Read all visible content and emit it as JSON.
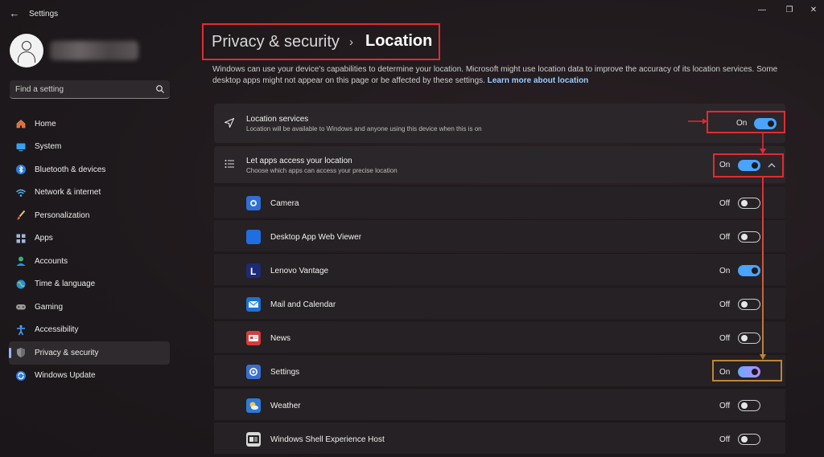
{
  "window": {
    "title": "Settings"
  },
  "profile": {
    "name_blurred": true
  },
  "search": {
    "placeholder": "Find a setting"
  },
  "sidebar": {
    "items": [
      {
        "label": "Home",
        "icon": "home-icon",
        "active": false
      },
      {
        "label": "System",
        "icon": "system-icon",
        "active": false
      },
      {
        "label": "Bluetooth & devices",
        "icon": "bluetooth-icon",
        "active": false
      },
      {
        "label": "Network & internet",
        "icon": "network-icon",
        "active": false
      },
      {
        "label": "Personalization",
        "icon": "brush-icon",
        "active": false
      },
      {
        "label": "Apps",
        "icon": "apps-icon",
        "active": false
      },
      {
        "label": "Accounts",
        "icon": "accounts-icon",
        "active": false
      },
      {
        "label": "Time & language",
        "icon": "globe-icon",
        "active": false
      },
      {
        "label": "Gaming",
        "icon": "gamepad-icon",
        "active": false
      },
      {
        "label": "Accessibility",
        "icon": "accessibility-icon",
        "active": false
      },
      {
        "label": "Privacy & security",
        "icon": "shield-icon",
        "active": true
      },
      {
        "label": "Windows Update",
        "icon": "update-icon",
        "active": false
      }
    ]
  },
  "breadcrumb": {
    "parent": "Privacy & security",
    "separator": "›",
    "current": "Location"
  },
  "description": {
    "text": "Windows can use your device's capabilities to determine your location. Microsoft might use location data to improve the accuracy of its location services. Some desktop apps might not appear on this page or be affected by these settings.",
    "link": "Learn more about location"
  },
  "location_services": {
    "title": "Location services",
    "subtitle": "Location will be available to Windows and anyone using this device when this is on",
    "state": "On"
  },
  "app_access": {
    "title": "Let apps access your location",
    "subtitle": "Choose which apps can access your precise location",
    "state": "On"
  },
  "apps": [
    {
      "name": "Camera",
      "state": "Off",
      "icon": "camera-icon",
      "color": "#2f6fd6"
    },
    {
      "name": "Desktop App Web Viewer",
      "state": "Off",
      "icon": "web-viewer-icon",
      "color": "#1f6fe0"
    },
    {
      "name": "Lenovo Vantage",
      "state": "On",
      "icon": "lenovo-vantage-icon",
      "color": "#1e2a78"
    },
    {
      "name": "Mail and Calendar",
      "state": "Off",
      "icon": "mail-icon",
      "color": "#1a73d6"
    },
    {
      "name": "News",
      "state": "Off",
      "icon": "news-icon",
      "color": "#d83b3b"
    },
    {
      "name": "Settings",
      "state": "On",
      "icon": "settings-gear-icon",
      "color": "#3a6fd0"
    },
    {
      "name": "Weather",
      "state": "Off",
      "icon": "weather-icon",
      "color": "#2f7ad8"
    },
    {
      "name": "Windows Shell Experience Host",
      "state": "Off",
      "icon": "shell-host-icon",
      "color": "#e0e0e0"
    }
  ],
  "colors": {
    "accent": "#4aa3ff",
    "highlight_red": "#e02b35",
    "highlight_gold": "#b9863e"
  }
}
